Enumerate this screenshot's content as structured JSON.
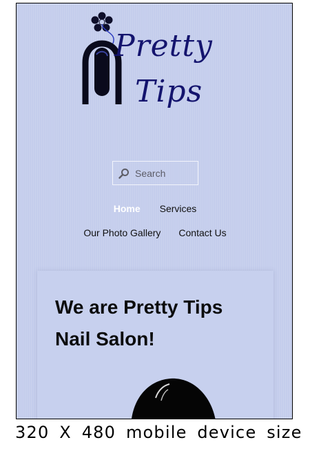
{
  "logo": {
    "word1": "Pretty",
    "word2": "Tips",
    "icon": "nail-flower-logo-icon"
  },
  "search": {
    "placeholder": "Search",
    "icon": "magnifier-icon"
  },
  "nav": {
    "items": [
      {
        "label": "Home",
        "active": true
      },
      {
        "label": "Services",
        "active": false
      },
      {
        "label": "Our Photo Gallery",
        "active": false
      },
      {
        "label": "Contact Us",
        "active": false
      }
    ]
  },
  "content": {
    "heading": "We are Pretty Tips Nail Salon!"
  },
  "caption": "320 X 480 mobile device size",
  "colors": {
    "background": "#c4cdec",
    "logo": "#14146e",
    "nav_active": "#ffffff"
  }
}
